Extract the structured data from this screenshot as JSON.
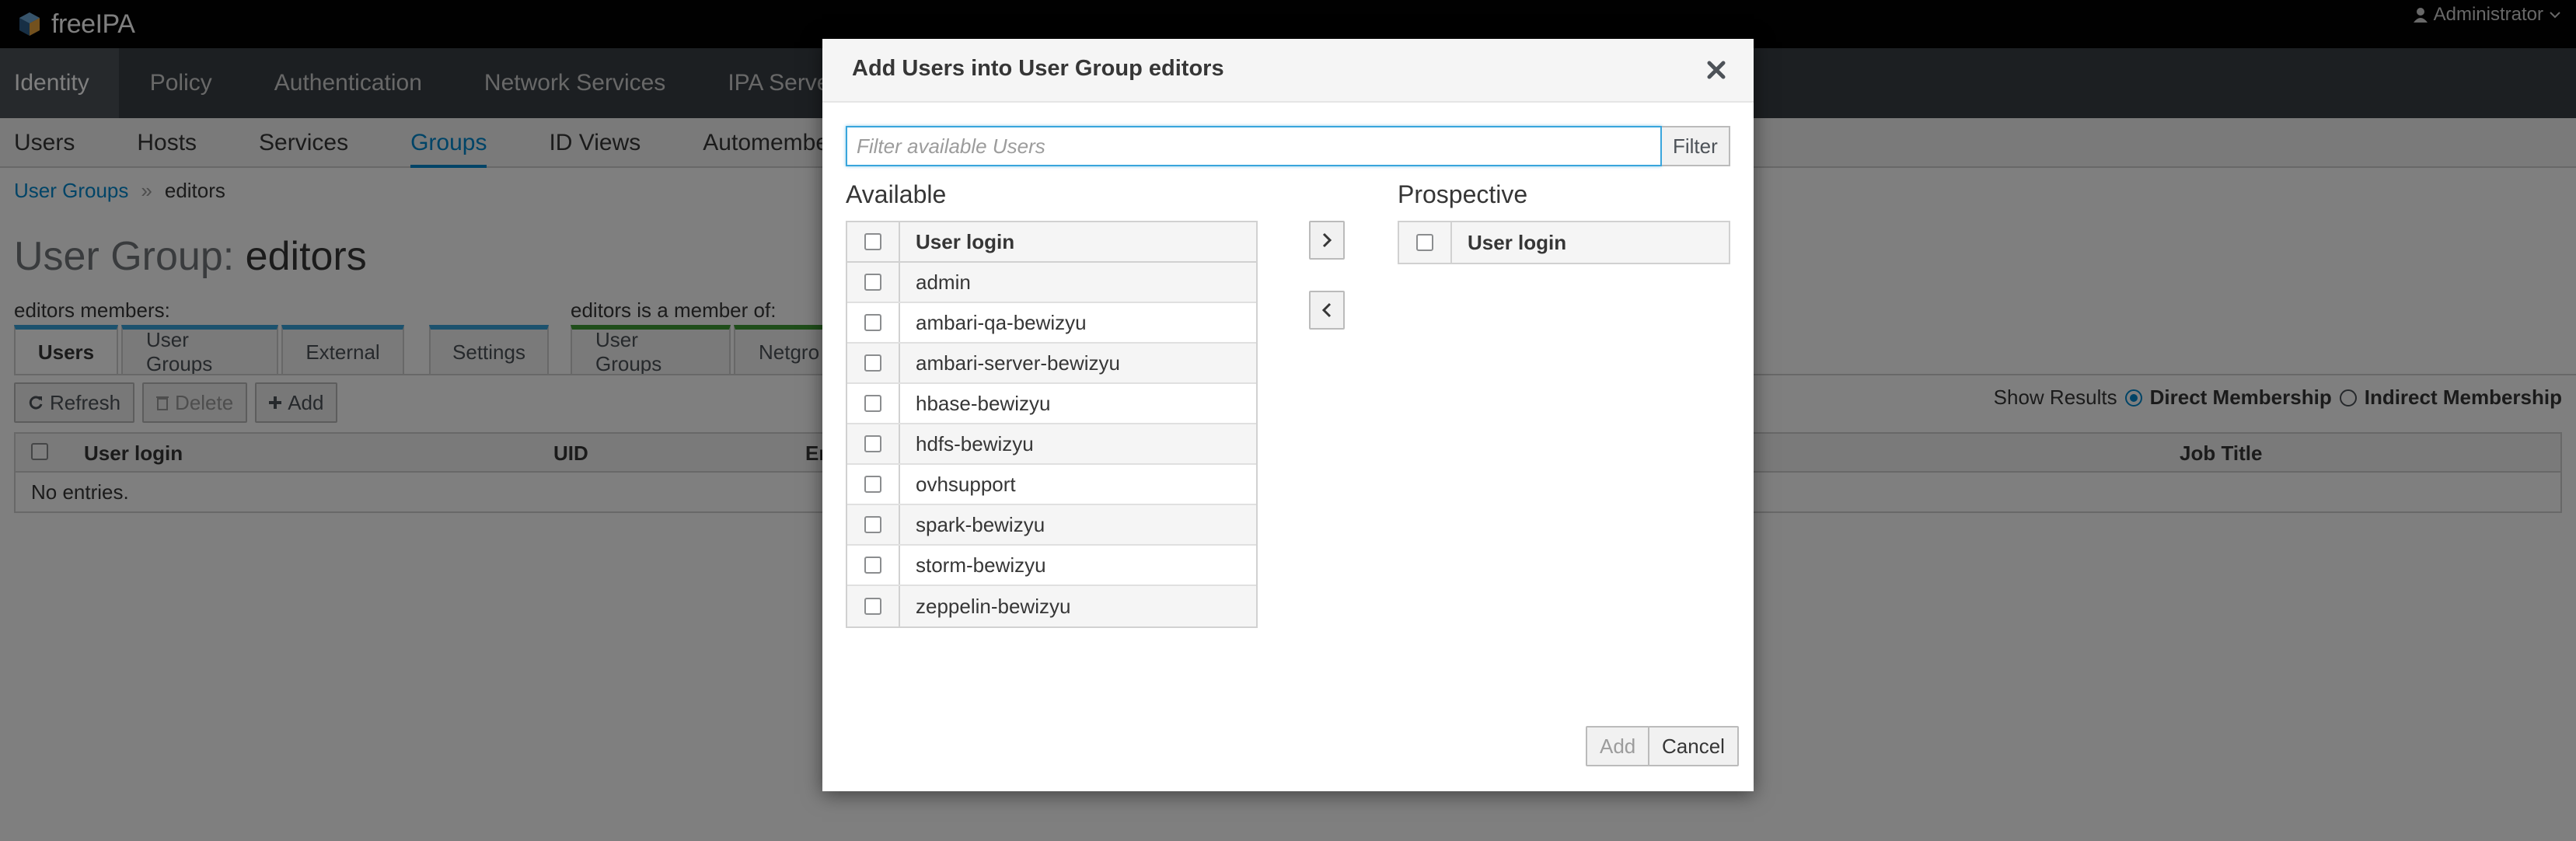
{
  "app": {
    "brand": "freeIPA",
    "user_menu": "Administrator"
  },
  "main_nav": [
    "Identity",
    "Policy",
    "Authentication",
    "Network Services",
    "IPA Server"
  ],
  "sub_nav": [
    "Users",
    "Hosts",
    "Services",
    "Groups",
    "ID Views",
    "Automember"
  ],
  "breadcrumb": {
    "parent": "User Groups",
    "separator": "»",
    "current": "editors"
  },
  "page_title": {
    "prefix": "User Group:",
    "name": "editors"
  },
  "members_section": {
    "label": "editors members:",
    "tabs": [
      "Users",
      "User Groups",
      "External"
    ]
  },
  "settings_tab": "Settings",
  "memberof_section": {
    "label": "editors is a member of:",
    "tabs": [
      "User Groups",
      "Netgro"
    ]
  },
  "actions": {
    "refresh": "Refresh",
    "delete": "Delete",
    "add": "Add"
  },
  "show_results": {
    "label": "Show Results",
    "direct": "Direct Membership",
    "indirect": "Indirect Membership"
  },
  "members_table": {
    "columns": [
      "User login",
      "UID",
      "Em",
      "Job Title"
    ],
    "empty": "No entries."
  },
  "modal": {
    "title": "Add Users into User Group editors",
    "filter_placeholder": "Filter available Users",
    "filter_value": "",
    "filter_button": "Filter",
    "available_label": "Available",
    "prospective_label": "Prospective",
    "column": "User login",
    "available_users": [
      "admin",
      "ambari-qa-bewizyu",
      "ambari-server-bewizyu",
      "hbase-bewizyu",
      "hdfs-bewizyu",
      "ovhsupport",
      "spark-bewizyu",
      "storm-bewizyu",
      "zeppelin-bewizyu"
    ],
    "prospective_users": [],
    "add_button": "Add",
    "cancel_button": "Cancel"
  }
}
